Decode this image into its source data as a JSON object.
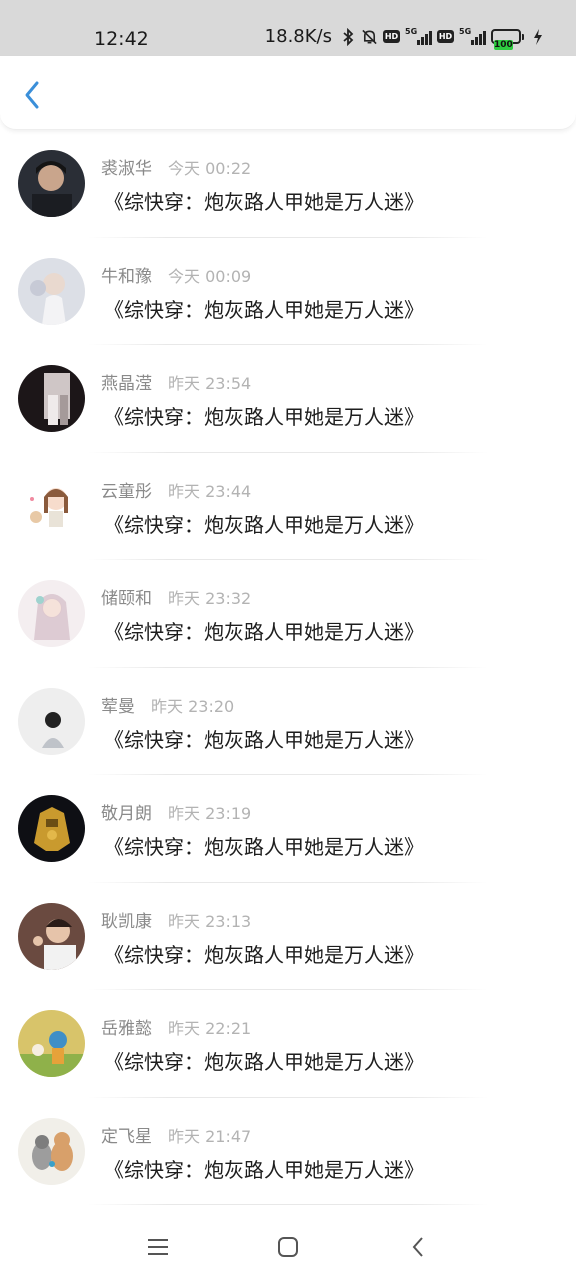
{
  "status_bar": {
    "time": "12:42",
    "net_speed": "18.8K/s",
    "icons": [
      "bluetooth-icon",
      "mute-bell-icon",
      "hd-icon",
      "5g-signal-icon",
      "hd-icon",
      "5g-signal-icon"
    ],
    "hd_label": "HD",
    "network_label": "5G",
    "battery_level": "100"
  },
  "header": {
    "back_icon": "chevron-left-icon",
    "accent_color": "#3b8fd9"
  },
  "items": [
    {
      "name": "裘淑华",
      "time": "今天 00:22",
      "content": "《综快穿：炮灰路人甲她是万人迷》"
    },
    {
      "name": "牛和豫",
      "time": "今天 00:09",
      "content": "《综快穿：炮灰路人甲她是万人迷》"
    },
    {
      "name": "燕晶滢",
      "time": "昨天 23:54",
      "content": "《综快穿：炮灰路人甲她是万人迷》"
    },
    {
      "name": "云童彤",
      "time": "昨天 23:44",
      "content": "《综快穿：炮灰路人甲她是万人迷》"
    },
    {
      "name": "储颐和",
      "time": "昨天 23:32",
      "content": "《综快穿：炮灰路人甲她是万人迷》"
    },
    {
      "name": "荤曼",
      "time": "昨天 23:20",
      "content": "《综快穿：炮灰路人甲她是万人迷》"
    },
    {
      "name": "敬月朗",
      "time": "昨天 23:19",
      "content": "《综快穿：炮灰路人甲她是万人迷》"
    },
    {
      "name": "耿凯康",
      "time": "昨天 23:13",
      "content": "《综快穿：炮灰路人甲她是万人迷》"
    },
    {
      "name": "岳雅懿",
      "time": "昨天 22:21",
      "content": "《综快穿：炮灰路人甲她是万人迷》"
    },
    {
      "name": "定飞星",
      "time": "昨天 21:47",
      "content": "《综快穿：炮灰路人甲她是万人迷》"
    }
  ],
  "nav_bar": {
    "icons": [
      "menu-icon",
      "home-square-icon",
      "back-triangle-icon"
    ]
  }
}
